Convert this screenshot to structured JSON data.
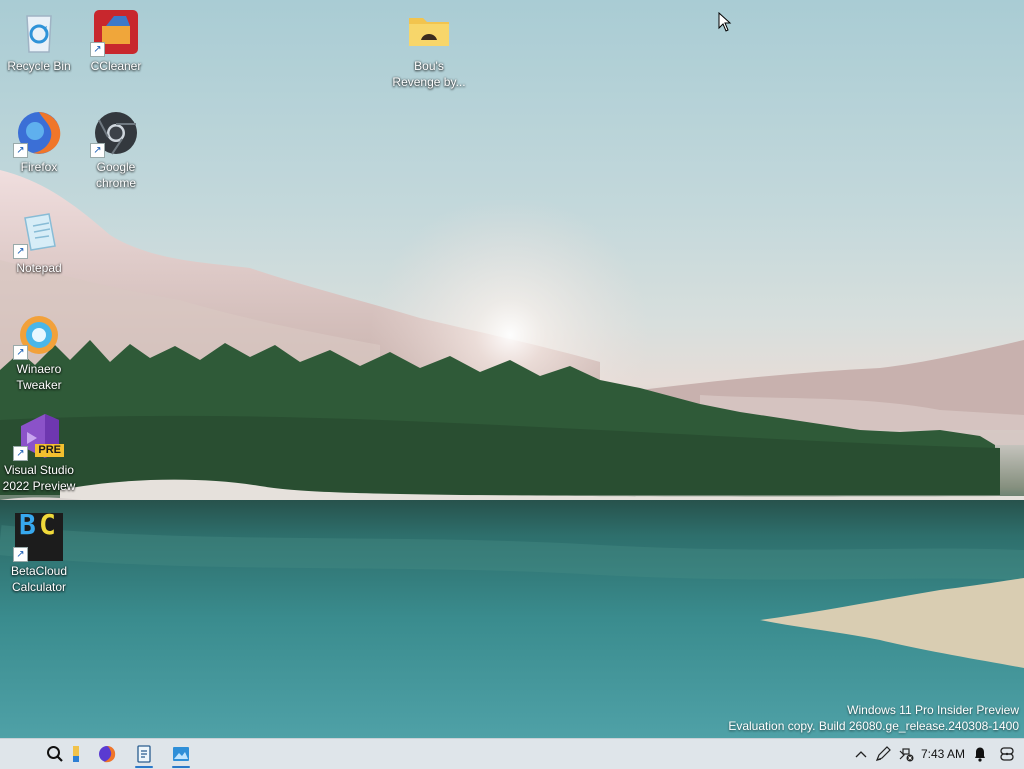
{
  "desktop": {
    "icons": [
      {
        "label": "Recycle Bin",
        "icon": "recycle-bin-icon",
        "shortcut": false
      },
      {
        "label": "CCleaner",
        "icon": "ccleaner-icon",
        "shortcut": true
      },
      {
        "label": "Bou's Revenge by...",
        "icon": "folder-icon",
        "shortcut": false
      },
      {
        "label": "Firefox",
        "icon": "firefox-icon",
        "shortcut": true
      },
      {
        "label": "Google chrome",
        "icon": "chrome-icon",
        "shortcut": true
      },
      {
        "label": "Notepad",
        "icon": "notepad-icon",
        "shortcut": true
      },
      {
        "label": "Winaero Tweaker",
        "icon": "winaero-tweaker-icon",
        "shortcut": true
      },
      {
        "label": "Visual Studio 2022 Preview",
        "icon": "visual-studio-icon",
        "shortcut": true,
        "badge": "PRE"
      },
      {
        "label": "BetaCloud Calculator",
        "icon": "betacloud-calculator-icon",
        "shortcut": true,
        "glyph1": "B",
        "glyph2": "C"
      }
    ]
  },
  "watermark": {
    "line1": "Windows 11 Pro Insider Preview",
    "line2": "Evaluation copy. Build 26080.ge_release.240308-1400"
  },
  "taskbar": {
    "items": [
      "search-icon",
      "file-explorer-icon",
      "firefox-icon",
      "notepad-icon",
      "photos-icon"
    ],
    "accent": "#2b79c9"
  },
  "tray": {
    "time": "7:43 AM",
    "icons": [
      "chevron-up-icon",
      "pen-icon",
      "network-disconnected-icon",
      "notification-bell-icon",
      "copilot-icon"
    ]
  }
}
